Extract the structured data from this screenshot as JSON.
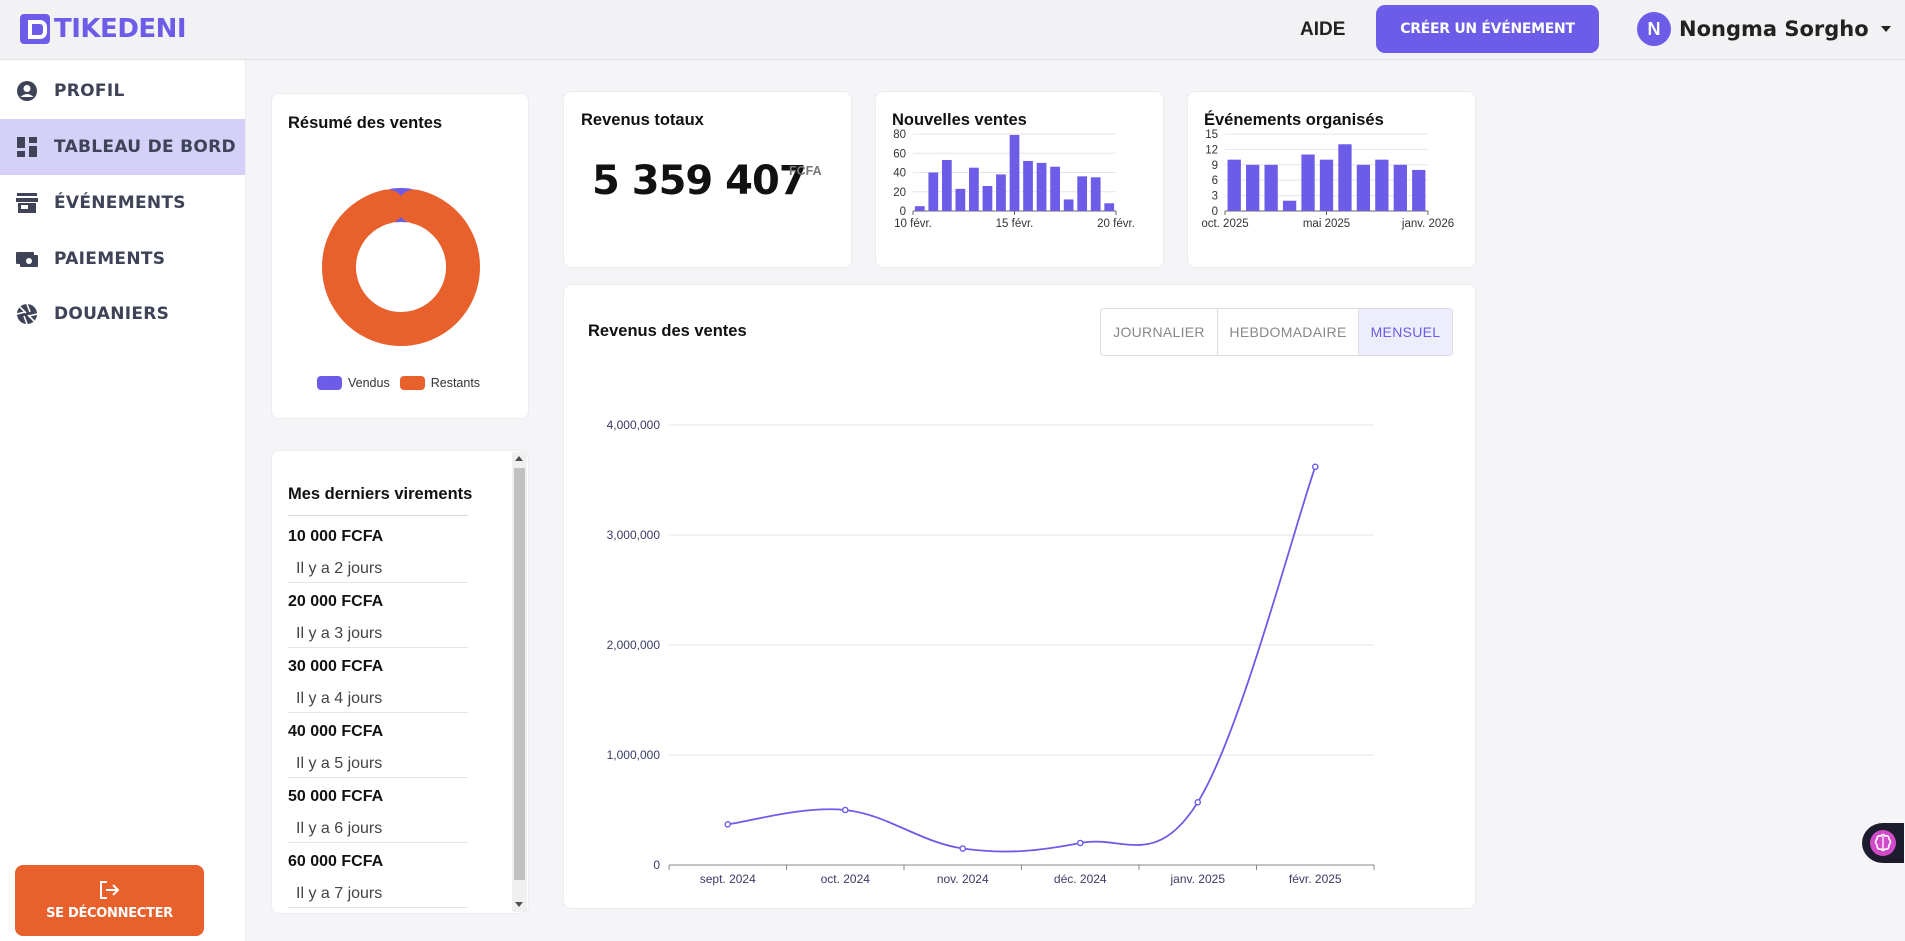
{
  "brand": {
    "name": "TIKEDENI",
    "color": "#6c5ce7"
  },
  "header": {
    "help": "AIDE",
    "create_event": "CRÉER UN ÉVÉNEMENT",
    "user": {
      "initial": "N",
      "name": "Nongma Sorgho"
    }
  },
  "sidebar": {
    "items": [
      {
        "label": "PROFIL",
        "icon": "user-circle-icon",
        "active": false
      },
      {
        "label": "TABLEAU DE BORD",
        "icon": "dashboard-icon",
        "active": true
      },
      {
        "label": "ÉVÉNEMENTS",
        "icon": "store-icon",
        "active": false
      },
      {
        "label": "PAIEMENTS",
        "icon": "payments-icon",
        "active": false
      },
      {
        "label": "DOUANIERS",
        "icon": "aperture-icon",
        "active": false
      }
    ],
    "logout": "SE DÉCONNECTER"
  },
  "sales_summary": {
    "title": "Résumé des ventes",
    "legend": [
      {
        "label": "Vendus",
        "color": "#6c5ce7"
      },
      {
        "label": "Restants",
        "color": "#e8602c"
      }
    ]
  },
  "total_revenue": {
    "title": "Revenus totaux",
    "value": "5 359 407",
    "unit": "FCFA"
  },
  "new_sales": {
    "title": "Nouvelles ventes"
  },
  "events_organized": {
    "title": "Événements organisés"
  },
  "sales_revenue": {
    "title": "Revenus des ventes",
    "periods": [
      {
        "label": "JOURNALIER",
        "active": false
      },
      {
        "label": "HEBDOMADAIRE",
        "active": false
      },
      {
        "label": "MENSUEL",
        "active": true
      }
    ]
  },
  "transfers": {
    "title": "Mes derniers virements",
    "items": [
      {
        "amount": "10 000 FCFA",
        "time": "Il y a 2 jours"
      },
      {
        "amount": "20 000 FCFA",
        "time": "Il y a 3 jours"
      },
      {
        "amount": "30 000 FCFA",
        "time": "Il y a 4 jours"
      },
      {
        "amount": "40 000 FCFA",
        "time": "Il y a 5 jours"
      },
      {
        "amount": "50 000 FCFA",
        "time": "Il y a 6 jours"
      },
      {
        "amount": "60 000 FCFA",
        "time": "Il y a 7 jours"
      }
    ]
  },
  "chart_data": [
    {
      "type": "pie",
      "labels": [
        "Vendus",
        "Restants"
      ],
      "values": [
        5,
        95
      ],
      "colors": [
        "#6c5ce7",
        "#e8602c"
      ],
      "legend": "bottom"
    },
    {
      "type": "bar",
      "title": "Nouvelles ventes",
      "values": [
        5,
        40,
        53,
        23,
        45,
        26,
        38,
        79,
        52,
        50,
        46,
        12,
        36,
        35,
        8
      ],
      "x_tick_labels": [
        "10 févr.",
        "15 févr.",
        "20 févr."
      ],
      "y_ticks": [
        0,
        20,
        40,
        60,
        80
      ],
      "ylim": [
        0,
        80
      ],
      "color": "#6c5ce7"
    },
    {
      "type": "bar",
      "title": "Événements organisés",
      "values": [
        10,
        9,
        9,
        2,
        11,
        10,
        13,
        9,
        10,
        9,
        8
      ],
      "x_tick_labels": [
        "oct. 2025",
        "mai 2025",
        "janv. 2026"
      ],
      "y_ticks": [
        0,
        3,
        6,
        9,
        12,
        15
      ],
      "ylim": [
        0,
        15
      ],
      "color": "#6c5ce7"
    },
    {
      "type": "line",
      "title": "Revenus des ventes",
      "categories": [
        "sept. 2024",
        "oct. 2024",
        "nov. 2024",
        "déc. 2024",
        "janv. 2025",
        "févr. 2025"
      ],
      "values": [
        370000,
        500000,
        150000,
        200000,
        570000,
        3620000
      ],
      "y_ticks": [
        "0",
        "1,000,000",
        "2,000,000",
        "3,000,000",
        "4,000,000"
      ],
      "y_tick_values": [
        0,
        1000000,
        2000000,
        3000000,
        4000000
      ],
      "ylim": [
        0,
        4000000
      ],
      "grid": true,
      "color": "#6c5ce7"
    }
  ]
}
